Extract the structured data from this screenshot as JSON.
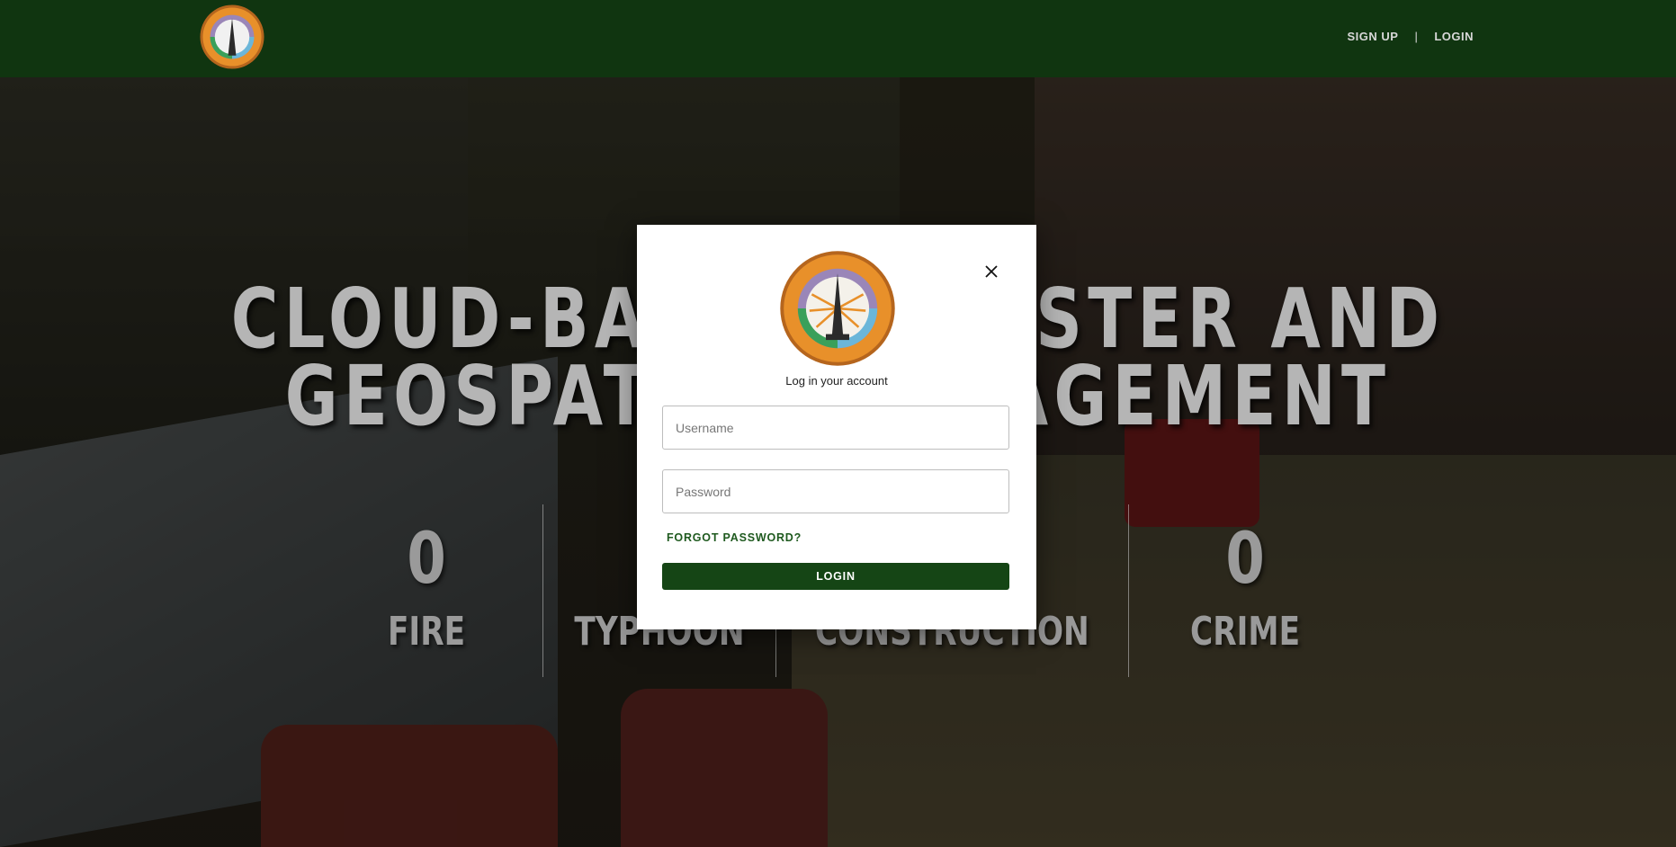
{
  "header": {
    "logo_icon": "seal-logo-icon",
    "nav": {
      "signup": "SIGN UP",
      "separator": "|",
      "login": "LOGIN"
    }
  },
  "hero": {
    "title_line1": "CLOUD-BASED DISASTER AND RISK",
    "title_line2": "GEOSPATIAL MANAGEMENT SYSTEM",
    "stats": [
      {
        "value": "0",
        "label": "FIRE"
      },
      {
        "value": "0",
        "label": "TYPHOON"
      },
      {
        "value": "0",
        "label": "CONSTRUCTION"
      },
      {
        "value": "0",
        "label": "CRIME"
      }
    ]
  },
  "modal": {
    "logo_icon": "seal-logo-icon",
    "close_icon": "close-icon",
    "subtitle": "Log in your account",
    "username_placeholder": "Username",
    "password_placeholder": "Password",
    "forgot_label": "FORGOT PASSWORD?",
    "login_label": "LOGIN"
  },
  "colors": {
    "header_bg": "#103510",
    "button_bg": "#154515",
    "link_green": "#1f5a1f",
    "seal_orange": "#e8902a"
  }
}
